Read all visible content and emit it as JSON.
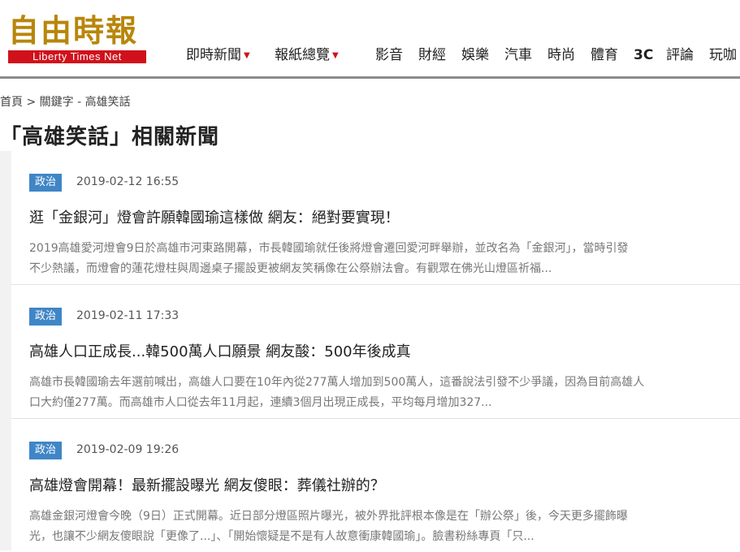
{
  "header": {
    "logo_cn": [
      "自",
      "由",
      "時",
      "報"
    ],
    "logo_en": "Liberty Times Net",
    "nav": [
      {
        "label": "即時新聞",
        "dropdown": true
      },
      {
        "label": "報紙總覽",
        "dropdown": true
      },
      {
        "label": "影音",
        "dropdown": false
      },
      {
        "label": "財經",
        "dropdown": false
      },
      {
        "label": "娛樂",
        "dropdown": false
      },
      {
        "label": "汽車",
        "dropdown": false
      },
      {
        "label": "時尚",
        "dropdown": false
      },
      {
        "label": "體育",
        "dropdown": false
      },
      {
        "label": "3C",
        "dropdown": false
      },
      {
        "label": "評論",
        "dropdown": false
      },
      {
        "label": "玩咖",
        "dropdown": false
      }
    ],
    "caret": "▼"
  },
  "breadcrumb": {
    "home": "首頁",
    "sep": ">",
    "keyword": "關鍵字 - 高雄笑話"
  },
  "page_title": "「高雄笑話」相關新聞",
  "articles": [
    {
      "category": "政治",
      "date": "2019-02-12 16:55",
      "title": "逛「金銀河」燈會許願韓國瑜這樣做 網友：絕對要實現！",
      "summary_line1": "2019高雄愛河燈會9日於高雄市河東路開幕，市長韓國瑜就任後將燈會遷回愛河畔舉辦，並改名為「金銀河」，當時引發",
      "summary_line2": "不少熱議，而燈會的蓮花燈柱與周邊桌子擺設更被網友笑稱像在公祭辦法會。有觀眾在佛光山燈區祈福..."
    },
    {
      "category": "政治",
      "date": "2019-02-11 17:33",
      "title": "高雄人口正成長...韓500萬人口願景 網友酸：500年後成真",
      "summary_line1": "高雄市長韓國瑜去年選前喊出，高雄人口要在10年內從277萬人增加到500萬人，這番說法引發不少爭議，因為目前高雄人",
      "summary_line2": "口大約僅277萬。而高雄市人口從去年11月起，連續3個月出現正成長，平均每月增加327..."
    },
    {
      "category": "政治",
      "date": "2019-02-09 19:26",
      "title": "高雄燈會開幕！最新擺設曝光 網友傻眼：葬儀社辦的？",
      "summary_line1": "高雄金銀河燈會今晚（9日）正式開幕。近日部分燈區照片曝光，被外界批評根本像是在「辦公祭」後，今天更多擺飾曝",
      "summary_line2": "光，也讓不少網友傻眼說「更像了...」、「開始懷疑是不是有人故意衝康韓國瑜」。臉書粉絲專頁「只..."
    }
  ],
  "colors": {
    "brand_red": "#d0111b",
    "logo_gold": "#b8860b",
    "badge_blue": "#3f86c6",
    "content_bg": "#f2f2f2",
    "summary_gray": "#777777"
  }
}
